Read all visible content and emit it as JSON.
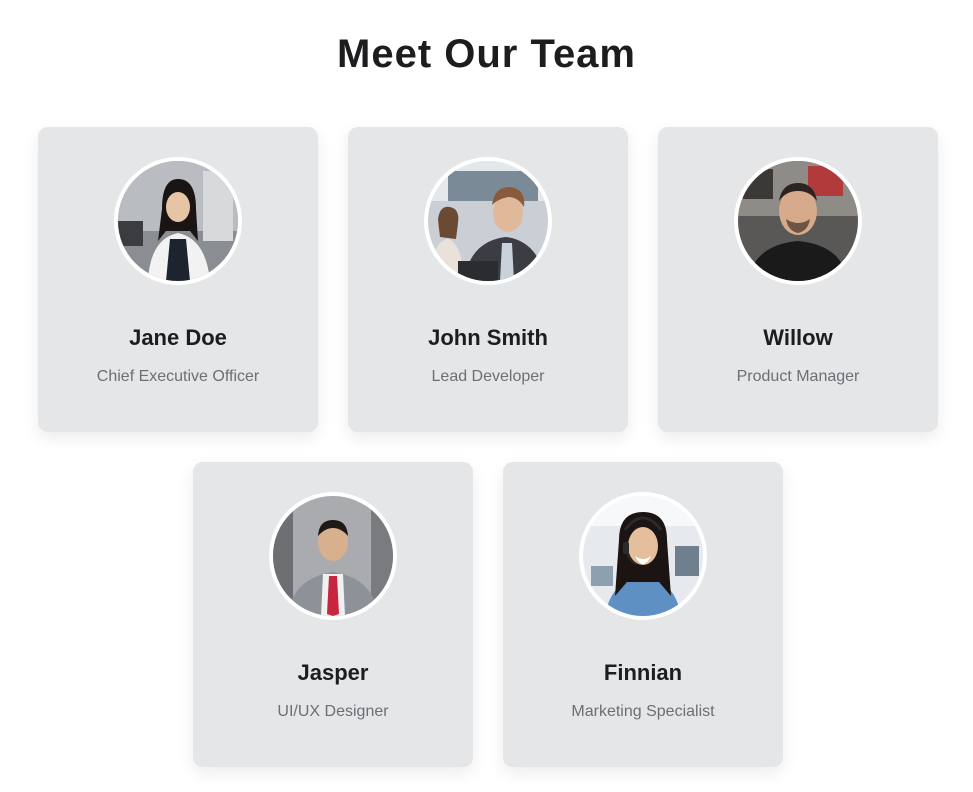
{
  "page": {
    "title": "Meet Our Team"
  },
  "colors": {
    "background": "#ffffff",
    "card": "#e5e6e8",
    "name_text": "#1d1d1f",
    "role_text": "#6b6f76",
    "avatar_ring": "#ffffff"
  },
  "team": [
    {
      "name": "Jane Doe",
      "role": "Chief Executive Officer",
      "photo": "woman-business-portrait"
    },
    {
      "name": "John Smith",
      "role": "Lead Developer",
      "photo": "man-office-portrait"
    },
    {
      "name": "Willow",
      "role": "Product Manager",
      "photo": "man-smiling-portrait"
    },
    {
      "name": "Jasper",
      "role": "UI/UX Designer",
      "photo": "man-suit-portrait"
    },
    {
      "name": "Finnian",
      "role": "Marketing Specialist",
      "photo": "woman-headset-portrait"
    }
  ]
}
